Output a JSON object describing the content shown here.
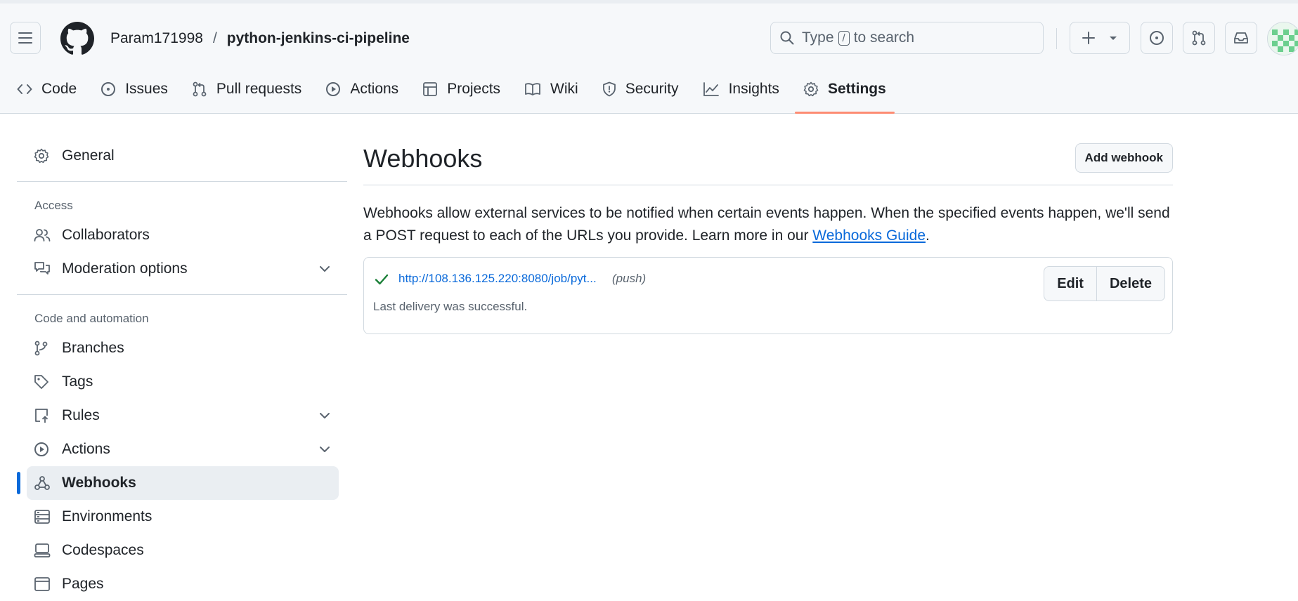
{
  "header": {
    "owner": "Param171998",
    "separator": "/",
    "repo": "python-jenkins-ci-pipeline",
    "search_prefix": "Type",
    "search_key": "/",
    "search_suffix": "to search"
  },
  "nav": {
    "tabs": [
      {
        "label": "Code",
        "icon": "code-icon"
      },
      {
        "label": "Issues",
        "icon": "issue-opened-icon"
      },
      {
        "label": "Pull requests",
        "icon": "git-pull-request-icon"
      },
      {
        "label": "Actions",
        "icon": "play-icon"
      },
      {
        "label": "Projects",
        "icon": "table-icon"
      },
      {
        "label": "Wiki",
        "icon": "book-icon"
      },
      {
        "label": "Security",
        "icon": "shield-icon"
      },
      {
        "label": "Insights",
        "icon": "graph-icon"
      },
      {
        "label": "Settings",
        "icon": "gear-icon"
      }
    ],
    "active": "Settings"
  },
  "sidebar": {
    "general": "General",
    "access_heading": "Access",
    "collaborators": "Collaborators",
    "moderation": "Moderation options",
    "code_heading": "Code and automation",
    "branches": "Branches",
    "tags": "Tags",
    "rules": "Rules",
    "actions": "Actions",
    "webhooks": "Webhooks",
    "environments": "Environments",
    "codespaces": "Codespaces",
    "pages": "Pages"
  },
  "main": {
    "title": "Webhooks",
    "add_button": "Add webhook",
    "description": "Webhooks allow external services to be notified when certain events happen. When the specified events happen, we'll send a POST request to each of the URLs you provide. Learn more in our ",
    "guide_link": "Webhooks Guide",
    "description_end": ".",
    "webhook": {
      "url": "http://108.136.125.220:8080/job/pyt...",
      "events": "(push)",
      "status": "Last delivery was successful.",
      "edit_label": "Edit",
      "delete_label": "Delete"
    }
  },
  "colors": {
    "accent": "#0969da",
    "active_tab_underline": "#fd8c73",
    "success": "#1a7f37"
  }
}
